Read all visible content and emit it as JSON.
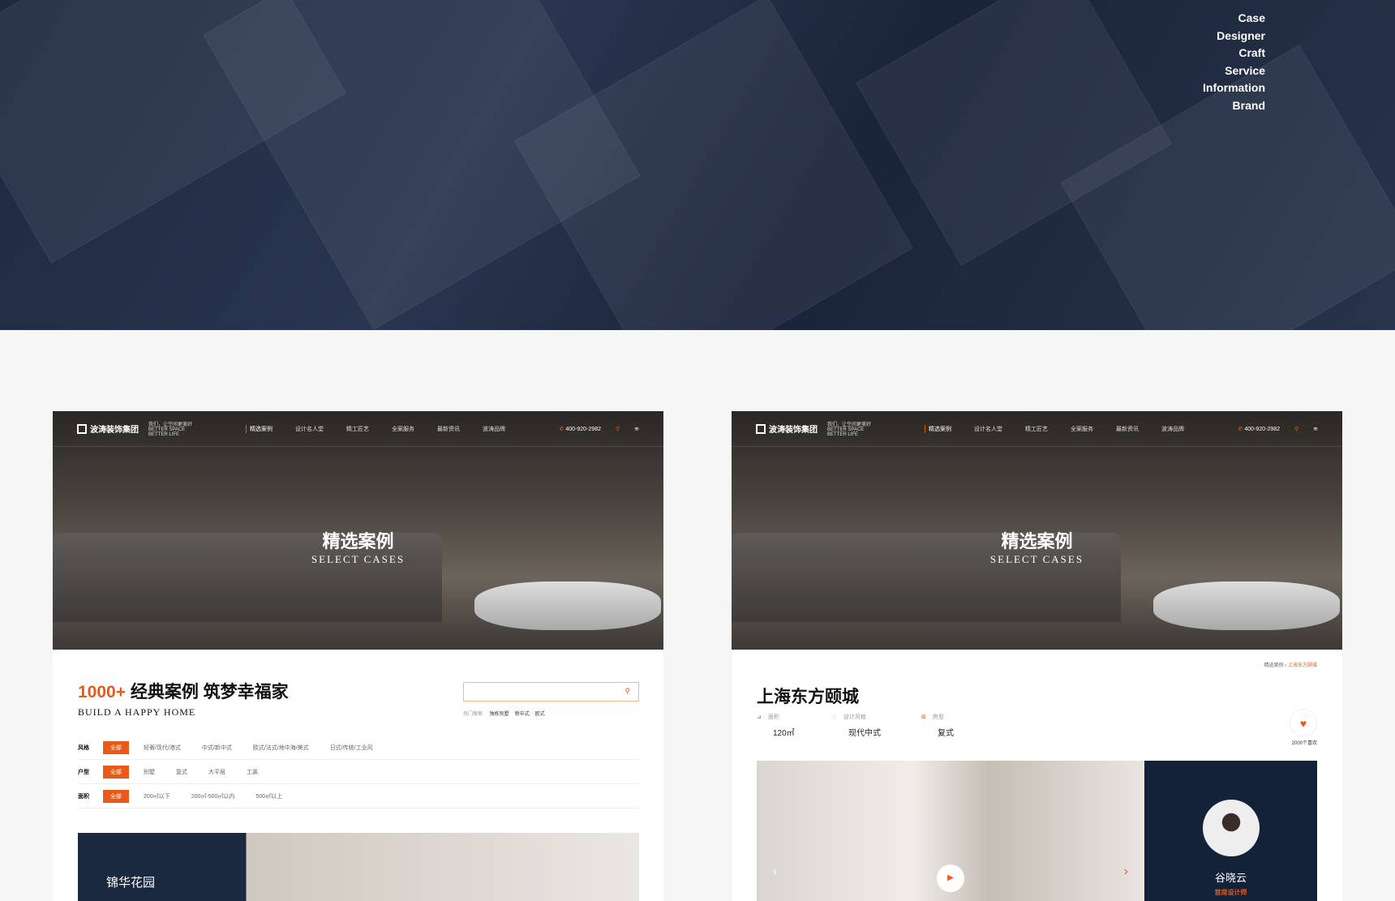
{
  "top_menu": [
    "Case",
    "Designer",
    "Craft",
    "Service",
    "Information",
    "Brand"
  ],
  "site": {
    "logo": "波涛装饰集团",
    "slogan": "我们，让空间更美好",
    "slogan_en": "BETTER SPACE BETTER LIFE",
    "nav": [
      "精选案例",
      "设计名人堂",
      "精工匠艺",
      "全案服务",
      "最新资讯",
      "波涛品牌"
    ],
    "phone": "400-920-2982"
  },
  "hero": {
    "title": "精选案例",
    "subtitle": "SELECT CASES"
  },
  "list_page": {
    "count": "1000+",
    "headline": "经典案例 筑梦幸福家",
    "english": "BUILD A HAPPY HOME",
    "hot_label": "热门搜索:",
    "hot": [
      "独栋别墅",
      "新中式",
      "欧式"
    ],
    "filters": [
      {
        "label": "风格",
        "all": "全部",
        "options": [
          "轻奢/现代/港式",
          "中式/新中式",
          "欧式/法式/地中海/美式",
          "日式/传统/工业风"
        ]
      },
      {
        "label": "户型",
        "all": "全部",
        "options": [
          "别墅",
          "复式",
          "大平层",
          "工装"
        ]
      },
      {
        "label": "面积",
        "all": "全部",
        "options": [
          "200㎡以下",
          "200㎡-500㎡以内",
          "500㎡以上"
        ]
      }
    ],
    "case_name": "锦华花园"
  },
  "detail_page": {
    "breadcrumb": [
      "精选案例",
      "上海东方颐城"
    ],
    "title": "上海东方颐城",
    "meta": [
      {
        "label": "面积",
        "value": "120㎡"
      },
      {
        "label": "设计风格",
        "value": "现代中式"
      },
      {
        "label": "房型",
        "value": "复式"
      }
    ],
    "likes": "2000个喜欢",
    "designer": {
      "name": "谷晓云",
      "role": "首席设计师"
    }
  },
  "colors": {
    "accent": "#e85a1a",
    "navy": "#132139"
  }
}
